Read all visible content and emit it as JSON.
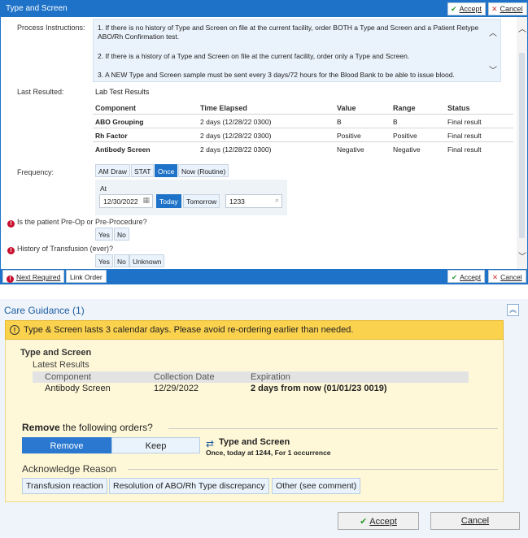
{
  "order_dialog": {
    "title": "Type and Screen",
    "accept_label": "Accept",
    "cancel_label": "Cancel",
    "process_label": "Process Instructions:",
    "instructions": [
      "1. If there is no history of Type and Screen on file at the current facility, order BOTH a Type and Screen and a Patient Retype",
      "ABO/Rh Confirmation test.",
      "2. If there is a history of a Type and Screen on file at the current facility, order only a Type and Screen.",
      "3. A NEW Type and Screen sample must be sent every 3 days/72 hours for the Blood Bank to be able to issue blood."
    ],
    "last_resulted_label": "Last Resulted:",
    "lab_title": "Lab Test Results",
    "lab_headers": [
      "Component",
      "Time Elapsed",
      "Value",
      "Range",
      "Status"
    ],
    "lab_rows": [
      [
        "ABO Grouping",
        "2 days (12/28/22 0300)",
        "B",
        "B",
        "Final result"
      ],
      [
        "Rh Factor",
        "2 days (12/28/22 0300)",
        "Positive",
        "Positive",
        "Final result"
      ],
      [
        "Antibody Screen",
        "2 days (12/28/22 0300)",
        "Negative",
        "Negative",
        "Final result"
      ]
    ],
    "frequency_label": "Frequency:",
    "frequency_options": [
      "AM Draw",
      "STAT",
      "Once",
      "Now (Routine)"
    ],
    "frequency_selected": "Once",
    "at_label": "At",
    "date_value": "12/30/2022",
    "today_label": "Today",
    "tomorrow_label": "Tomorrow",
    "time_value": "1233",
    "q1_label": "Is the patient Pre-Op or Pre-Procedure?",
    "q1_options": [
      "Yes",
      "No"
    ],
    "q2_label": "History of Transfusion (ever)?",
    "q2_options": [
      "Yes",
      "No",
      "Unknown"
    ],
    "next_required_label": "Next Required",
    "link_order_label": "Link Order",
    "colors": {
      "accent": "#1e73c8",
      "selected": "#1e73c8",
      "warning": "#c8102e"
    }
  },
  "care_guidance": {
    "title": "Care Guidance (1)",
    "banner": "Type & Screen lasts 3 calendar days. Please avoid re-ordering earlier than needed.",
    "section_title": "Type and Screen",
    "latest_results_label": "Latest Results",
    "result_headers": [
      "Component",
      "Collection Date",
      "Expiration"
    ],
    "result_row": [
      "Antibody Screen",
      "12/29/2022",
      "2 days from now (01/01/23 0019)"
    ],
    "remove_bold": "Remove",
    "remove_rest": " the following orders?",
    "remove_label": "Remove",
    "keep_label": "Keep",
    "order_name": "Type and Screen",
    "order_detail": "Once, today at 1244, For 1 occurrence",
    "ack_title": "Acknowledge Reason",
    "reasons": [
      "Transfusion reaction",
      "Resolution of ABO/Rh Type discrepancy",
      "Other (see comment)"
    ],
    "accept_label": "Accept",
    "cancel_label": "Cancel",
    "colors": {
      "banner": "#fbd24e",
      "remove_selected": "#2b78d0"
    }
  }
}
